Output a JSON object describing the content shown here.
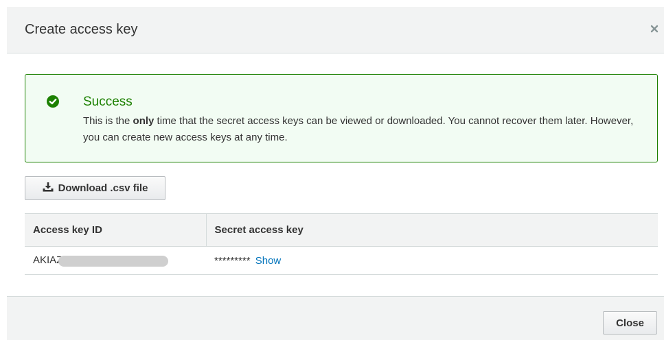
{
  "dialog": {
    "title": "Create access key",
    "close_icon": "close-x-icon"
  },
  "alert": {
    "icon": "check-circle-icon",
    "title": "Success",
    "body_prefix": "This is the ",
    "body_bold": "only",
    "body_suffix": " time that the secret access keys can be viewed or downloaded. You cannot recover them later. However, you can create new access keys at any time.",
    "color": "#1d8102"
  },
  "download_button": {
    "icon": "download-icon",
    "label": "Download .csv file"
  },
  "table": {
    "headers": [
      "Access key ID",
      "Secret access key"
    ],
    "rows": [
      {
        "access_key_id": "AKIAZ",
        "secret_masked": "*********",
        "show_label": "Show"
      }
    ]
  },
  "footer": {
    "close_label": "Close"
  },
  "colors": {
    "link": "#0073bb",
    "header_bg": "#f2f3f3",
    "success_bg": "#f2fcf3"
  }
}
